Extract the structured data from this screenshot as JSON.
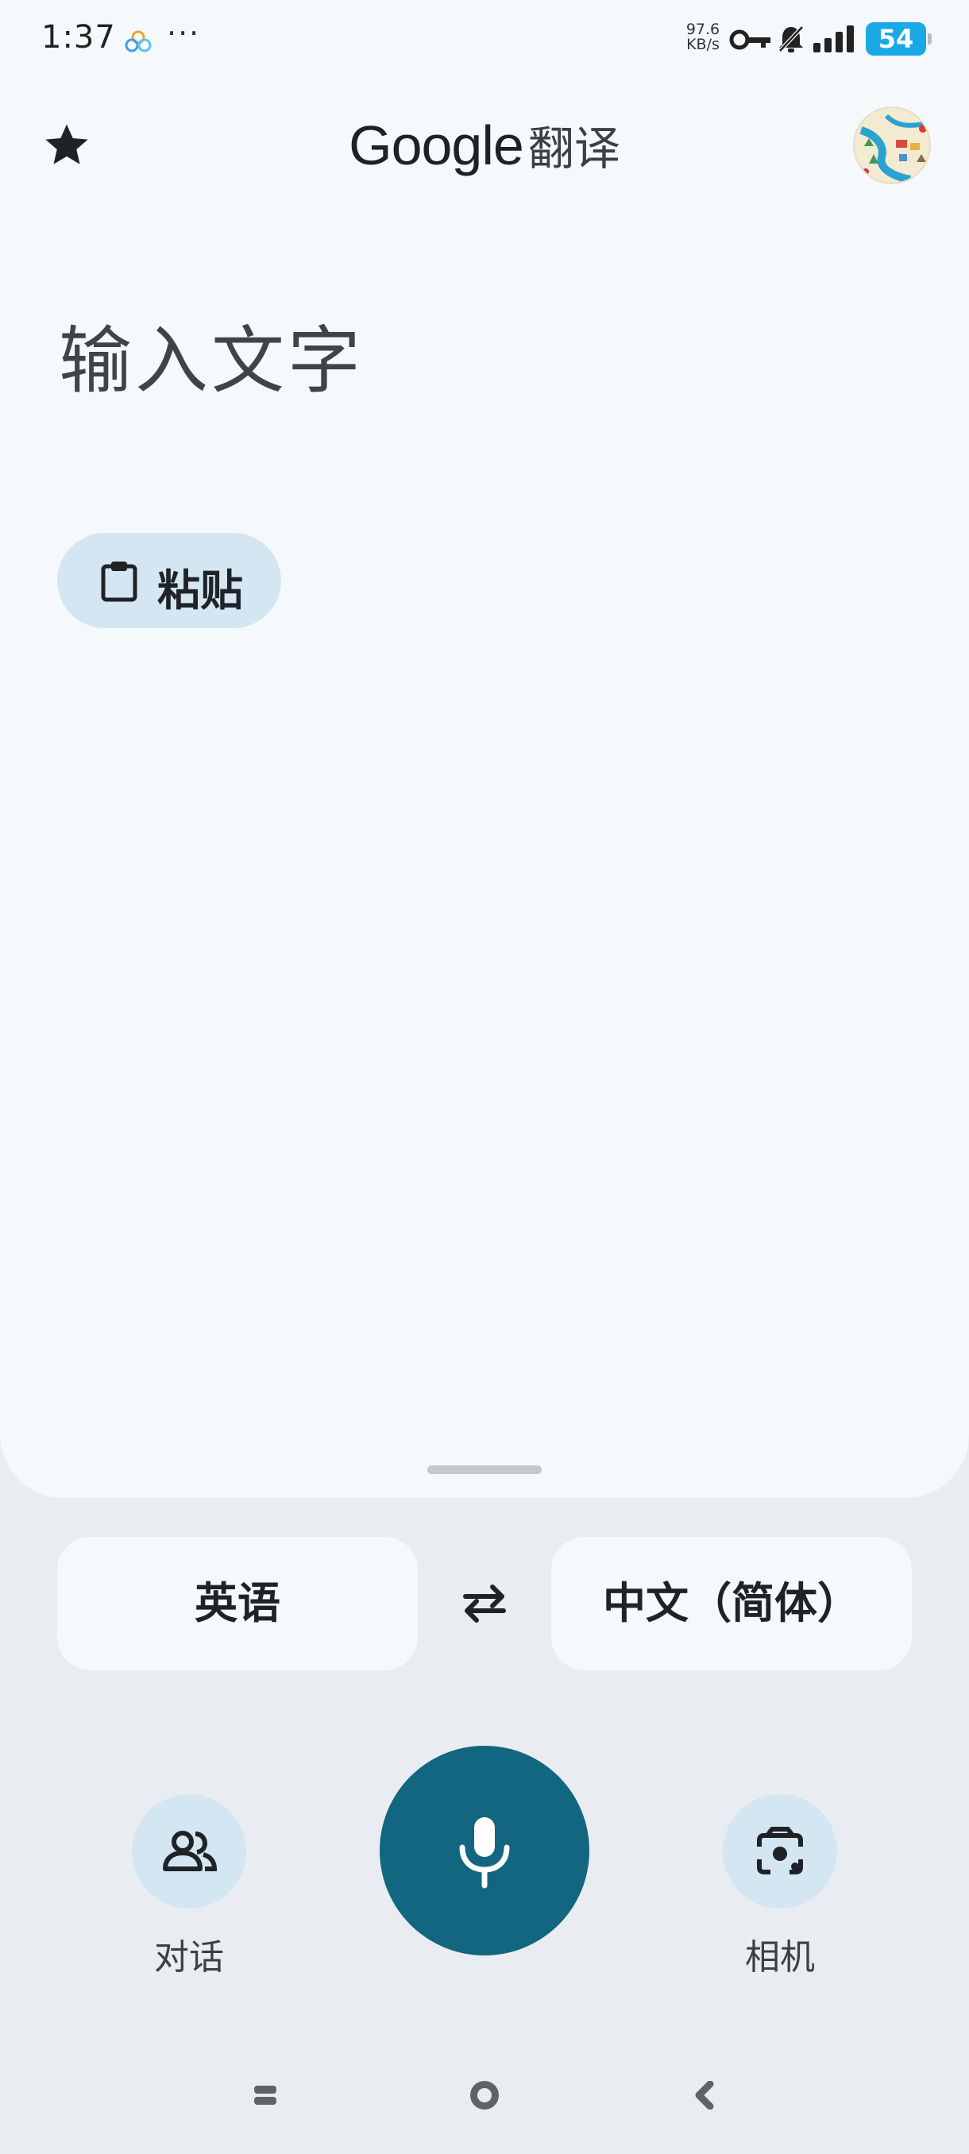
{
  "status_bar": {
    "time": "1:37",
    "more": "···",
    "net_speed_value": "97.6",
    "net_speed_unit": "KB/s",
    "battery": "54",
    "icons": [
      "app-notification-icon",
      "key-icon",
      "bell-muted-icon",
      "signal-icon",
      "battery-icon"
    ]
  },
  "app_bar": {
    "brand": "Google",
    "brand_suffix": "翻译",
    "left_icon": "star-icon",
    "right_icon": "avatar"
  },
  "input": {
    "placeholder": "输入文字"
  },
  "paste_chip": {
    "label": "粘贴",
    "icon": "clipboard-icon"
  },
  "languages": {
    "source": "英语",
    "target": "中文（简体）",
    "swap_icon": "swap-arrows-icon"
  },
  "actions": {
    "conversation_label": "对话",
    "camera_label": "相机",
    "mic_icon": "microphone-icon"
  },
  "colors": {
    "sheet": "#f6f9fc",
    "background": "#e9edf2",
    "chip": "#d3e6f2",
    "mic": "#12667f",
    "battery": "#1aa9e6"
  }
}
